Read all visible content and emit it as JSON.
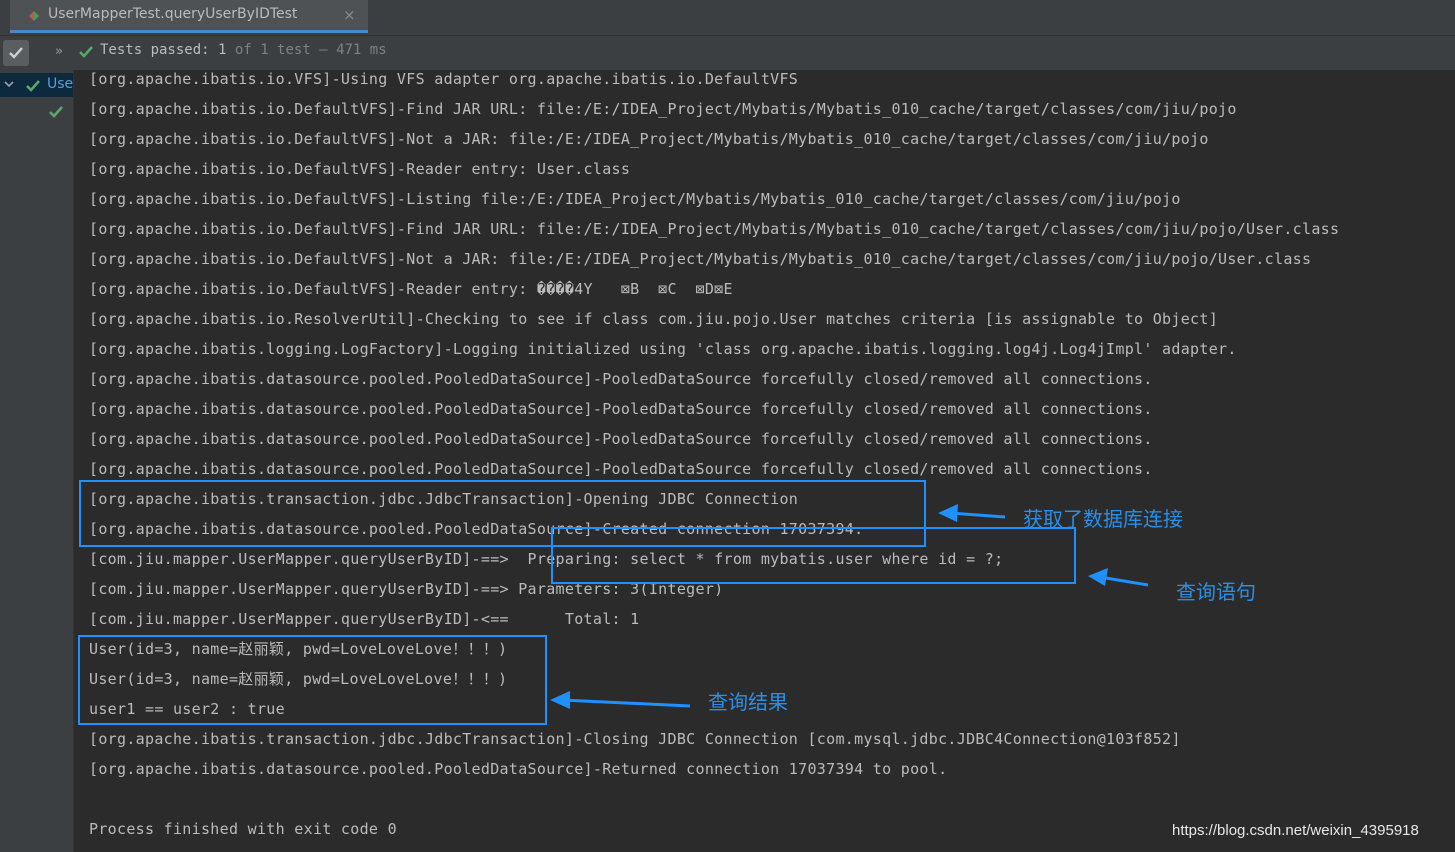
{
  "tab": {
    "title": "UserMapperTest.queryUserByIDTest",
    "close": "×"
  },
  "toolbar": {
    "status_label": "Tests passed:",
    "passed": "1",
    "of": "of",
    "total": "1 test",
    "separator": "–",
    "time": "471 ms"
  },
  "tree": {
    "root_label": "UserMapperTest"
  },
  "console": {
    "lines": [
      "[org.apache.ibatis.io.VFS]-Using VFS adapter org.apache.ibatis.io.DefaultVFS",
      "[org.apache.ibatis.io.DefaultVFS]-Find JAR URL: file:/E:/IDEA_Project/Mybatis/Mybatis_010_cache/target/classes/com/jiu/pojo",
      "[org.apache.ibatis.io.DefaultVFS]-Not a JAR: file:/E:/IDEA_Project/Mybatis/Mybatis_010_cache/target/classes/com/jiu/pojo",
      "[org.apache.ibatis.io.DefaultVFS]-Reader entry: User.class",
      "[org.apache.ibatis.io.DefaultVFS]-Listing file:/E:/IDEA_Project/Mybatis/Mybatis_010_cache/target/classes/com/jiu/pojo",
      "[org.apache.ibatis.io.DefaultVFS]-Find JAR URL: file:/E:/IDEA_Project/Mybatis/Mybatis_010_cache/target/classes/com/jiu/pojo/User.class",
      "[org.apache.ibatis.io.DefaultVFS]-Not a JAR: file:/E:/IDEA_Project/Mybatis/Mybatis_010_cache/target/classes/com/jiu/pojo/User.class",
      "[org.apache.ibatis.io.DefaultVFS]-Reader entry: ����4Y   ⊠B  ⊠C  ⊠D⊠E",
      "[org.apache.ibatis.io.ResolverUtil]-Checking to see if class com.jiu.pojo.User matches criteria [is assignable to Object]",
      "[org.apache.ibatis.logging.LogFactory]-Logging initialized using 'class org.apache.ibatis.logging.log4j.Log4jImpl' adapter.",
      "[org.apache.ibatis.datasource.pooled.PooledDataSource]-PooledDataSource forcefully closed/removed all connections.",
      "[org.apache.ibatis.datasource.pooled.PooledDataSource]-PooledDataSource forcefully closed/removed all connections.",
      "[org.apache.ibatis.datasource.pooled.PooledDataSource]-PooledDataSource forcefully closed/removed all connections.",
      "[org.apache.ibatis.datasource.pooled.PooledDataSource]-PooledDataSource forcefully closed/removed all connections.",
      "[org.apache.ibatis.transaction.jdbc.JdbcTransaction]-Opening JDBC Connection",
      "[org.apache.ibatis.datasource.pooled.PooledDataSource]-Created connection 17037394.",
      "[com.jiu.mapper.UserMapper.queryUserByID]-==>  Preparing: select * from mybatis.user where id = ?;",
      "[com.jiu.mapper.UserMapper.queryUserByID]-==> Parameters: 3(Integer)",
      "[com.jiu.mapper.UserMapper.queryUserByID]-<==      Total: 1",
      "User(id=3, name=赵丽颖, pwd=LoveLoveLove！！！)",
      "User(id=3, name=赵丽颖, pwd=LoveLoveLove！！！)",
      "user1 == user2 : true",
      "[org.apache.ibatis.transaction.jdbc.JdbcTransaction]-Closing JDBC Connection [com.mysql.jdbc.JDBC4Connection@103f852]",
      "[org.apache.ibatis.datasource.pooled.PooledDataSource]-Returned connection 17037394 to pool.",
      "",
      "Process finished with exit code 0"
    ]
  },
  "annotations": {
    "connection": "获取了数据库连接",
    "query": "查询语句",
    "result": "查询结果",
    "accent_color": "#1e90ff"
  },
  "watermark": "https://blog.csdn.net/weixin_4395918"
}
